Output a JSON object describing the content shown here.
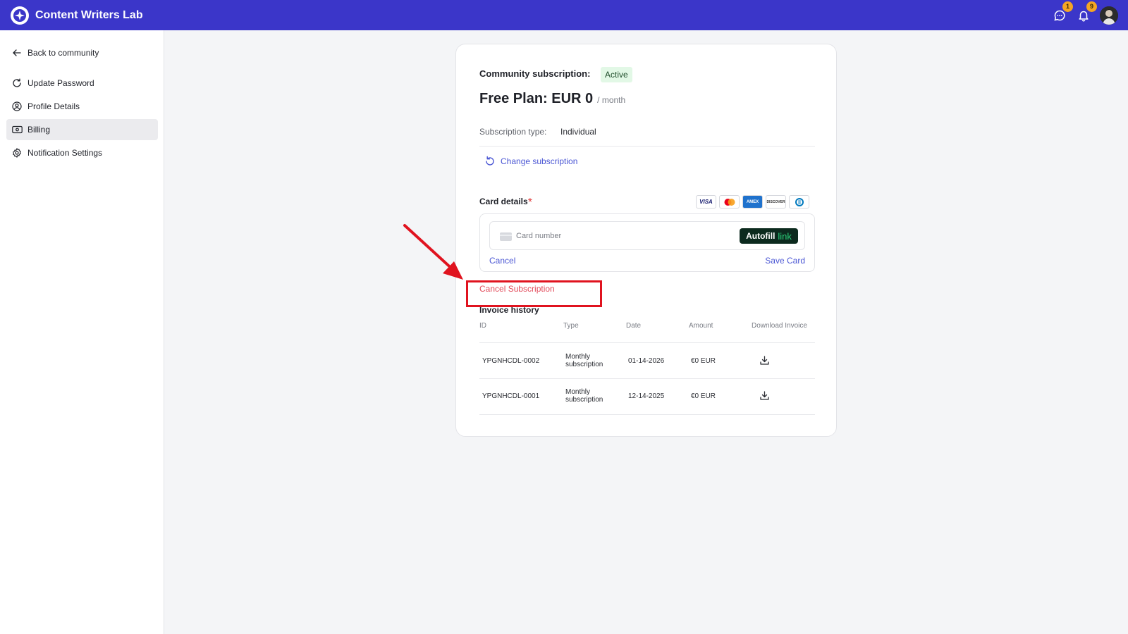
{
  "header": {
    "app_name": "Content Writers Lab",
    "chat_badge": "1",
    "notifications_badge": "9",
    "brand_color": "#3b36c9"
  },
  "sidebar": {
    "back_label": "Back to community",
    "items": [
      {
        "label": "Update Password",
        "icon": "refresh-icon"
      },
      {
        "label": "Profile Details",
        "icon": "user-circle-icon"
      },
      {
        "label": "Billing",
        "icon": "billing-icon",
        "active": true
      },
      {
        "label": "Notification Settings",
        "icon": "gear-icon"
      }
    ]
  },
  "subscription": {
    "label": "Community subscription:",
    "status": "Active",
    "plan_title": "Free Plan: EUR 0",
    "plan_period": "/ month",
    "type_label": "Subscription type:",
    "type_value": "Individual",
    "change_label": "Change subscription"
  },
  "card_details": {
    "label": "Card details",
    "required_mark": "*",
    "brands": [
      "VISA",
      "Mastercard",
      "AMEX",
      "DISCOVER",
      "Diners Club"
    ],
    "card_number_placeholder": "Card number",
    "autofill_label": "Autofill",
    "autofill_link": "link",
    "cancel_label": "Cancel",
    "save_label": "Save Card"
  },
  "cancel_subscription_label": "Cancel Subscription",
  "invoices": {
    "title": "Invoice history",
    "columns": [
      "ID",
      "Type",
      "Date",
      "Amount",
      "Download Invoice"
    ],
    "rows": [
      {
        "id": "YPGNHCDL-0002",
        "type_line1": "Monthly",
        "type_line2": "subscription",
        "date": "01-14-2026",
        "amount": "€0 EUR"
      },
      {
        "id": "YPGNHCDL-0001",
        "type_line1": "Monthly",
        "type_line2": "subscription",
        "date": "12-14-2025",
        "amount": "€0 EUR"
      }
    ]
  }
}
